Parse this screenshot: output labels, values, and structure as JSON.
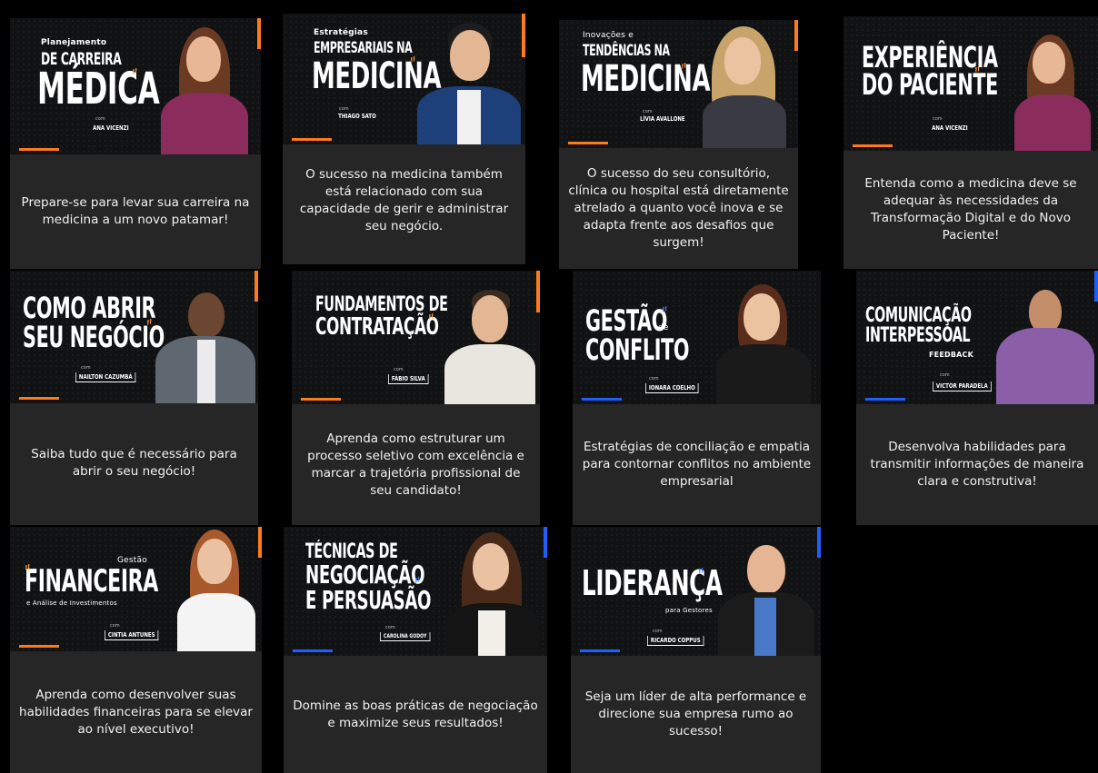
{
  "courses": [
    {
      "title_small": "Planejamento",
      "title_lines": [
        "DE CARREIRA",
        "MÉDICA"
      ],
      "with": "com",
      "presenter": "ANA VICENZI",
      "description": "Prepare-se para levar sua carreira na medicina a um novo patamar!"
    },
    {
      "title_small": "Estratégias",
      "title_lines": [
        "EMPRESARIAIS NA",
        "MEDICINA"
      ],
      "with": "com",
      "presenter": "THIAGO SATO",
      "description": "O sucesso na medicina também está relacionado com sua capacidade de gerir e administrar seu negócio."
    },
    {
      "title_small": "Inovações e",
      "title_lines": [
        "TENDÊNCIAS NA",
        "MEDICINA"
      ],
      "with": "com",
      "presenter": "LÍVIA AVALLONE",
      "description": "O sucesso do seu consultório, clínica ou hospital está diretamente atrelado a quanto você inova e se adapta frente aos desafios que surgem!"
    },
    {
      "title_small": "",
      "title_lines": [
        "EXPERIÊNCIA",
        "DO PACIENTE"
      ],
      "with": "com",
      "presenter": "ANA VICENZI",
      "description": "Entenda como a medicina deve se adequar às necessidades da Transformação Digital e do Novo Paciente!"
    },
    {
      "title_small": "",
      "title_lines": [
        "COMO ABRIR",
        "SEU NEGÓCIO"
      ],
      "with": "com",
      "presenter": "NAILTON CAZUMBÁ",
      "description": "Saiba tudo que é necessário para abrir o seu negócio!"
    },
    {
      "title_small": "",
      "title_lines": [
        "FUNDAMENTOS DE",
        "CONTRATAÇÃO"
      ],
      "with": "com",
      "presenter": "FÁBIO SILVA",
      "description": "Aprenda como estruturar um processo seletivo com excelência e marcar a trajetória profissional de seu candidato!"
    },
    {
      "title_small": "de",
      "title_lines": [
        "GESTÃO",
        "CONFLITO"
      ],
      "with": "com",
      "presenter": "IONARA COELHO",
      "description": "Estratégias de conciliação e empatia para contornar conflitos no ambiente empresarial"
    },
    {
      "title_small": "FEEDBACK",
      "title_lines": [
        "COMUNICAÇÃO",
        "INTERPESSOAL"
      ],
      "with": "com",
      "presenter": "VICTOR PARADELA",
      "description": "Desenvolva habilidades para transmitir informações de maneira clara e construtiva!"
    },
    {
      "title_small": "Gestão",
      "title_sub": "e Análise de Investimentos",
      "title_lines": [
        "FINANCEIRA"
      ],
      "with": "com",
      "presenter": "CINTIA ANTUNES",
      "description": "Aprenda como desenvolver suas habilidades financeiras para se elevar ao nível executivo!"
    },
    {
      "title_small": "",
      "title_lines": [
        "TÉCNICAS DE",
        "NEGOCIAÇÃO",
        "E PERSUASÃO"
      ],
      "with": "com",
      "presenter": "CAROLINA GODOY",
      "description": "Domine as boas práticas de negociação e maximize seus resultados!"
    },
    {
      "title_small": "para Gestores",
      "title_lines": [
        "LIDERANÇA"
      ],
      "with": "com",
      "presenter": "RICARDO COPPUS",
      "description": "Seja um líder de alta performance e direcione sua empresa rumo ao sucesso!"
    }
  ],
  "colors": {
    "accent_orange": "#ff7a1a",
    "accent_blue": "#1f5fff",
    "card_bg": "#262626",
    "banner_bg": "#111214",
    "page_bg": "#000000"
  }
}
